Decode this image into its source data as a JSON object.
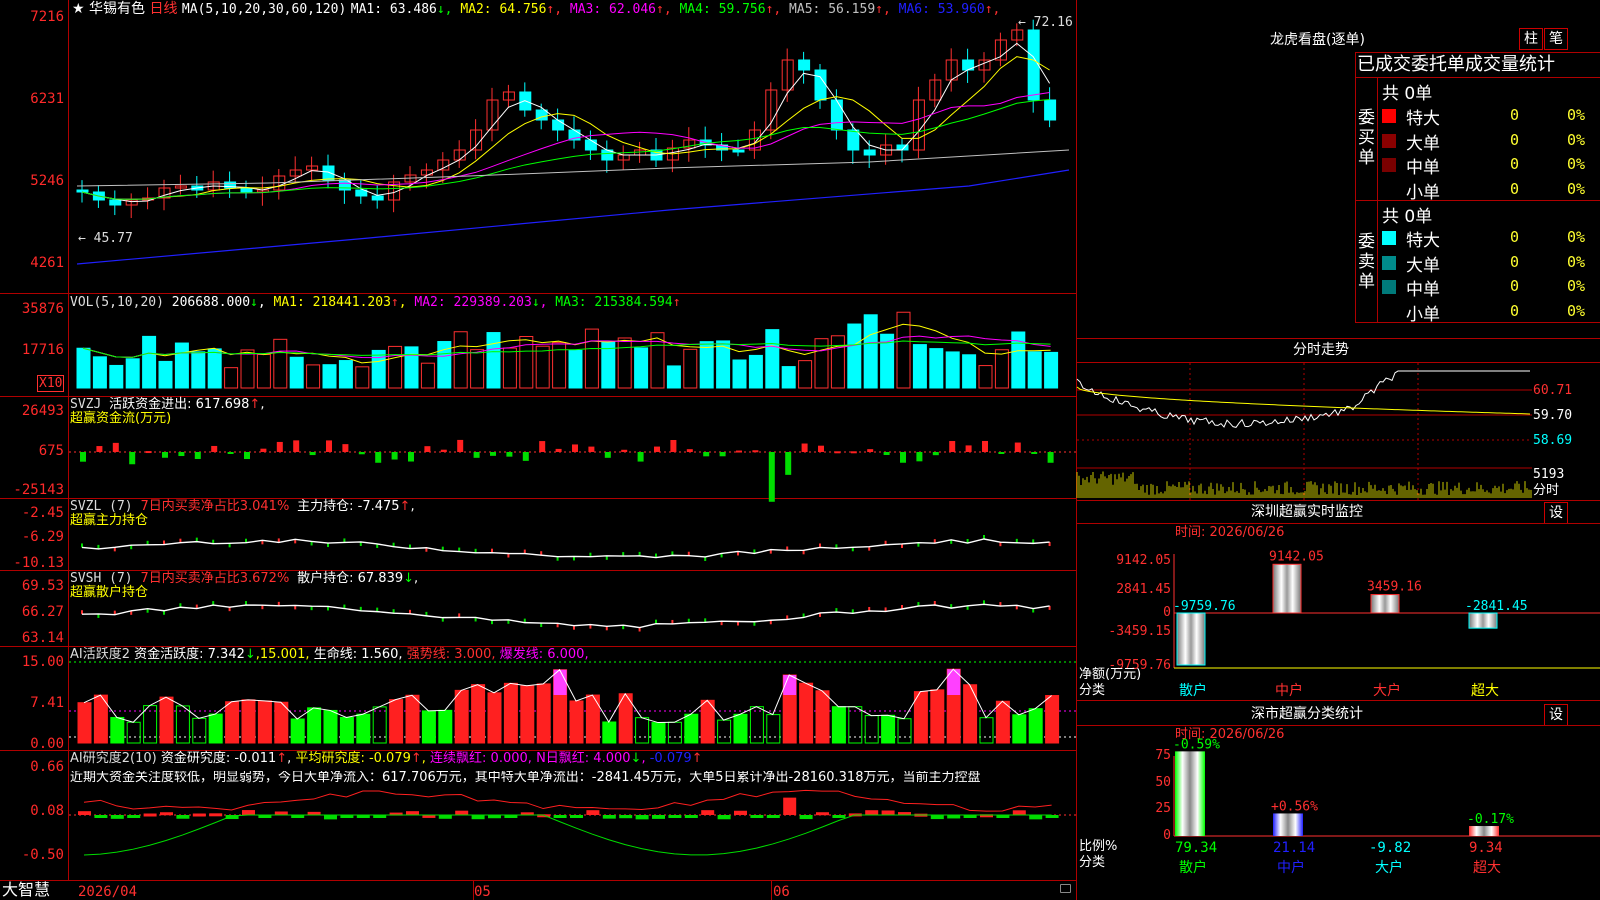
{
  "stock": {
    "name": "华锡有色",
    "period": "日线",
    "star": "★"
  },
  "main": {
    "ma_prefix": "MA(5,10,20,30,60,120)",
    "ma": [
      {
        "label": "MA1: 63.486",
        "arrow": "↓",
        "color": "#ffffff"
      },
      {
        "label": "MA2: 64.756",
        "arrow": "↑",
        "color": "#ffff00"
      },
      {
        "label": "MA3: 62.046",
        "arrow": "↑",
        "color": "#ff00ff"
      },
      {
        "label": "MA4: 59.756",
        "arrow": "↑",
        "color": "#00ff00"
      },
      {
        "label": "MA5: 56.159",
        "arrow": "↑",
        "color": "#c0c0c0"
      },
      {
        "label": "MA6: 53.960",
        "arrow": "↑",
        "color": "#2020ff"
      }
    ],
    "yaxis": [
      "7216",
      "6231",
      "5246",
      "4261"
    ],
    "high_mark": "72.16",
    "low_mark": "45.77"
  },
  "vol": {
    "title": "VOL(5,10,20)",
    "value": "206688.000",
    "value_arrow": "↓",
    "ma1": "MA1: 218441.203",
    "ma1_arrow": "↑",
    "ma2": "MA2: 229389.203",
    "ma2_arrow": "↓",
    "ma3": "MA3: 215384.594",
    "ma3_arrow": "↑",
    "yaxis": [
      "35876",
      "17716"
    ],
    "unit": "X10"
  },
  "svzj": {
    "title": "SVZJ",
    "label": "活跃资金进出: 617.698",
    "arrow": "↑",
    "suffix": ",",
    "sub": "超赢资金流(万元)",
    "yaxis": [
      "26493",
      "675",
      "-25143"
    ]
  },
  "svzl": {
    "title": "SVZL (7)",
    "label": "7日内买卖净占比3.041%",
    "label2": "主力持仓: -7.475",
    "arrow": "↑",
    "suffix": ",",
    "sub": "超赢主力持仓",
    "yaxis": [
      "-2.45",
      "-6.29",
      "-10.13"
    ]
  },
  "svsh": {
    "title": "SVSH (7)",
    "label": "7日内买卖净占比3.672%",
    "label2": "散户持仓: 67.839",
    "arrow": "↓",
    "suffix": ",",
    "sub": "超赢散户持仓",
    "yaxis": [
      "69.53",
      "66.27",
      "63.14"
    ]
  },
  "ai1": {
    "title": "AI活跃度2",
    "label": "资金活跃度: 7.342",
    "arrow": "↓",
    "v2": ",15.001,",
    "life": "生命线: 1.560,",
    "strong": "强势线: 3.000,",
    "burst": "爆发线: 6.000,",
    "yaxis": [
      "15.00",
      "7.41",
      "0.00"
    ]
  },
  "ai2": {
    "title": "AI研究度2(10)",
    "label": "资金研究度: -0.011",
    "arrow": "↑",
    "avg": "平均研究度: -0.079",
    "avg_arrow": "↑",
    "red": "连续飘红: 0.000,",
    "nred": "N日飘红: 4.000",
    "nred_arrow": "↓",
    "neg": "-0.079",
    "neg_arrow": "↑",
    "desc": "近期大资金关注度较低，明显弱势，今日大单净流入：617.706万元，其中特大单净流出：-2841.45万元，大单5日累计净出-28160.318万元，当前主力控盘",
    "yaxis": [
      "0.66",
      "0.08",
      "-0.50"
    ]
  },
  "footer": {
    "brand": "大智慧",
    "dates": [
      "2026/04",
      "05",
      "06"
    ]
  },
  "right": {
    "dragon": {
      "title": "龙虎看盘(逐单)",
      "btn1": "柱",
      "btn2": "笔",
      "tabs": "已成交委托单成交量统计",
      "buy": {
        "side": "委买单",
        "total": "共 0单",
        "rows": [
          {
            "label": "特大",
            "v": "0",
            "p": "0%",
            "color": "#ff0000"
          },
          {
            "label": "大单",
            "v": "0",
            "p": "0%",
            "color": "#8b0000"
          },
          {
            "label": "中单",
            "v": "0",
            "p": "0%",
            "color": "#7a0000"
          },
          {
            "label": "小单",
            "v": "0",
            "p": "0%",
            "color": "#000000"
          }
        ]
      },
      "sell": {
        "side": "委卖单",
        "total": "共 0单",
        "rows": [
          {
            "label": "特大",
            "v": "0",
            "p": "0%",
            "color": "#00ffff"
          },
          {
            "label": "大单",
            "v": "0",
            "p": "0%",
            "color": "#008b8b"
          },
          {
            "label": "中单",
            "v": "0",
            "p": "0%",
            "color": "#007a7a"
          },
          {
            "label": "小单",
            "v": "0",
            "p": "0%",
            "color": "#000000"
          }
        ]
      }
    },
    "intraday": {
      "title": "分时走势",
      "prices": [
        "60.71",
        "59.70",
        "58.69"
      ],
      "vol": "5193",
      "unit": "分时"
    },
    "monitor": {
      "title": "深圳超赢实时监控",
      "set": "设",
      "time": "时间: 2026/06/26",
      "yaxis": [
        "9142.05",
        "2841.45",
        "0",
        "-3459.15",
        "-9759.76"
      ],
      "ylabel": "净额(万元)",
      "xlabel": "分类",
      "cats": [
        "散户",
        "中户",
        "大户",
        "超大"
      ],
      "values": [
        -9759.76,
        9142.05,
        3459.16,
        -2841.45
      ],
      "value_labels": [
        "-9759.76",
        "9142.05",
        "3459.16",
        "-2841.45"
      ]
    },
    "classify": {
      "title": "深市超赢分类统计",
      "set": "设",
      "time": "时间: 2026/06/26",
      "yaxis": [
        "75",
        "50",
        "25",
        "0"
      ],
      "ylabel": "比例%",
      "xlabel": "分类",
      "cats": [
        "散户",
        "中户",
        "大户",
        "超大"
      ],
      "top_labels": [
        "-0.59%",
        "+0.56%",
        "",
        "-0.17%"
      ],
      "bottom_labels": [
        "79.34",
        "21.14",
        "-9.82",
        "9.34"
      ],
      "values": [
        79.34,
        21.14,
        -9.82,
        9.34
      ]
    }
  }
}
